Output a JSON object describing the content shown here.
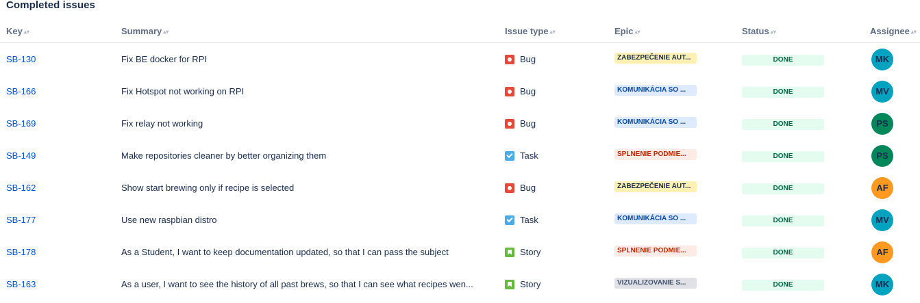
{
  "section_title": "Completed issues",
  "columns": {
    "key": "Key",
    "summary": "Summary",
    "issue_type": "Issue type",
    "epic": "Epic",
    "status": "Status",
    "assignee": "Assignee"
  },
  "sort_icon": "sort-arrows-icon",
  "epic_colors": {
    "ZABEZPEČENIE AUT...": {
      "bg": "#fff0b3",
      "fg": "#172b4d"
    },
    "KOMUNIKÁCIA SO ...": {
      "bg": "#deebff",
      "fg": "#0747a6"
    },
    "SPLNENIE PODMIE...": {
      "bg": "#ffebe6",
      "fg": "#bf2600"
    },
    "VIZUALIZOVANIE S...": {
      "bg": "#dfe1e6",
      "fg": "#42526e"
    }
  },
  "avatar_colors": {
    "MK": "#00a3bf",
    "MV": "#00a3bf",
    "PS": "#00875a",
    "AF": "#ff991f"
  },
  "status_color": {
    "bg": "#e3fcef",
    "fg": "#006644"
  },
  "rows": [
    {
      "key": "SB-130",
      "summary": "Fix BE docker for RPI",
      "type": "Bug",
      "type_icon": "bug-icon",
      "epic": "ZABEZPEČENIE AUT...",
      "status": "DONE",
      "assignee": "MK"
    },
    {
      "key": "SB-166",
      "summary": "Fix Hotspot not working on RPI",
      "type": "Bug",
      "type_icon": "bug-icon",
      "epic": "KOMUNIKÁCIA SO ...",
      "status": "DONE",
      "assignee": "MV"
    },
    {
      "key": "SB-169",
      "summary": "Fix relay not working",
      "type": "Bug",
      "type_icon": "bug-icon",
      "epic": "KOMUNIKÁCIA SO ...",
      "status": "DONE",
      "assignee": "PS"
    },
    {
      "key": "SB-149",
      "summary": "Make repositories cleaner by better organizing them",
      "type": "Task",
      "type_icon": "task-icon",
      "epic": "SPLNENIE PODMIE...",
      "status": "DONE",
      "assignee": "PS"
    },
    {
      "key": "SB-162",
      "summary": "Show start brewing only if recipe is selected",
      "type": "Bug",
      "type_icon": "bug-icon",
      "epic": "ZABEZPEČENIE AUT...",
      "status": "DONE",
      "assignee": "AF"
    },
    {
      "key": "SB-177",
      "summary": "Use new raspbian distro",
      "type": "Task",
      "type_icon": "task-icon",
      "epic": "KOMUNIKÁCIA SO ...",
      "status": "DONE",
      "assignee": "MV"
    },
    {
      "key": "SB-178",
      "summary": "As a Student, I want to keep documentation updated, so that I can pass the subject",
      "type": "Story",
      "type_icon": "story-icon",
      "epic": "SPLNENIE PODMIE...",
      "status": "DONE",
      "assignee": "AF"
    },
    {
      "key": "SB-163",
      "summary": "As a user, I want to see the history of all past brews, so that I can see what recipes wen...",
      "type": "Story",
      "type_icon": "story-icon",
      "epic": "VIZUALIZOVANIE S...",
      "status": "DONE",
      "assignee": "MK"
    }
  ]
}
